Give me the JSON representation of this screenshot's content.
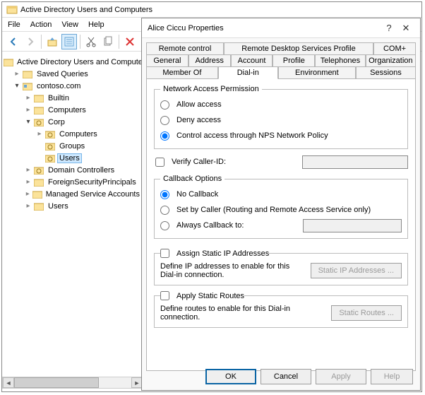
{
  "main": {
    "title": "Active Directory Users and Computers",
    "menu": {
      "file": "File",
      "action": "Action",
      "view": "View",
      "help": "Help"
    }
  },
  "tree": {
    "root": "Active Directory Users and Computers",
    "saved": "Saved Queries",
    "domain": "contoso.com",
    "builtin": "Builtin",
    "computers": "Computers",
    "corp": "Corp",
    "corp_computers": "Computers",
    "corp_groups": "Groups",
    "corp_users": "Users",
    "dc": "Domain Controllers",
    "fsp": "ForeignSecurityPrincipals",
    "msa": "Managed Service Accounts",
    "users": "Users"
  },
  "dialog": {
    "title": "Alice Ciccu Properties",
    "tabs": {
      "remote_control": "Remote control",
      "rdsp": "Remote Desktop Services Profile",
      "complus": "COM+",
      "general": "General",
      "address": "Address",
      "account": "Account",
      "profile": "Profile",
      "telephones": "Telephones",
      "organization": "Organization",
      "memberof": "Member Of",
      "dialin": "Dial-in",
      "environment": "Environment",
      "sessions": "Sessions"
    },
    "groups": {
      "nap": "Network Access Permission",
      "callback": "Callback Options"
    },
    "radios": {
      "allow": "Allow access",
      "deny": "Deny access",
      "nps": "Control access through NPS Network Policy",
      "nocb": "No Callback",
      "setby": "Set by Caller (Routing and Remote Access Service only)",
      "always": "Always Callback to:"
    },
    "checks": {
      "verify": "Verify Caller-ID:",
      "static_ip": "Assign Static IP Addresses",
      "static_routes": "Apply Static Routes"
    },
    "hints": {
      "ip": "Define IP addresses to enable for this Dial-in connection.",
      "routes": "Define routes to enable for this Dial-in connection."
    },
    "buttons": {
      "static_ip": "Static IP Addresses ...",
      "static_routes": "Static Routes ...",
      "ok": "OK",
      "cancel": "Cancel",
      "apply": "Apply",
      "help": "Help"
    }
  }
}
